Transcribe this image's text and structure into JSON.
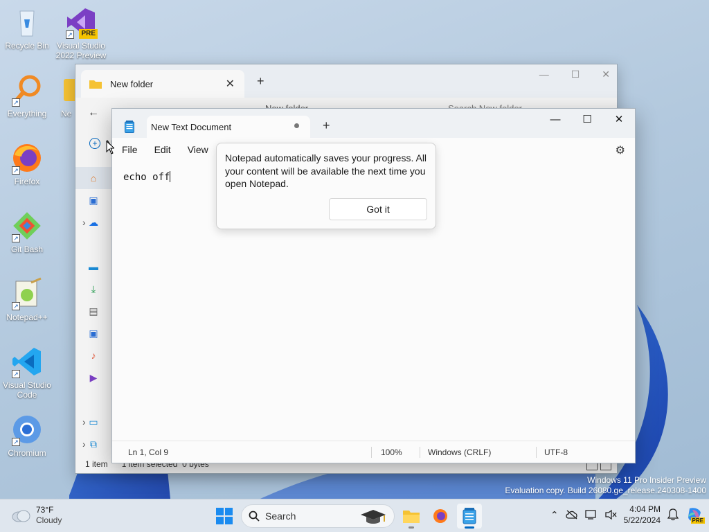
{
  "desktop": {
    "icons": [
      {
        "label": "Recycle Bin"
      },
      {
        "label": "Visual Studio 2022 Preview",
        "badge": "PRE"
      },
      {
        "label": "Everything"
      },
      {
        "label": "Firefox"
      },
      {
        "label": "Git Bash"
      },
      {
        "label": "Notepad++"
      },
      {
        "label": "Visual Studio Code"
      },
      {
        "label": "Chromium"
      }
    ],
    "partial_icon_label": "Ne"
  },
  "explorer": {
    "tab_title": "New folder",
    "address_partial": "New folder",
    "search_placeholder": "Search New folder",
    "new_button_partial": "N",
    "status_items": "1 item",
    "status_selected": "1 item selected  0 bytes"
  },
  "notepad": {
    "tab_title": "New Text Document",
    "menu": {
      "file": "File",
      "edit": "Edit",
      "view": "View"
    },
    "content": "echo off",
    "status": {
      "position": "Ln 1, Col 9",
      "zoom": "100%",
      "line_ending": "Windows (CRLF)",
      "encoding": "UTF-8"
    }
  },
  "teaching_tip": {
    "message": "Notepad automatically saves your progress. All your content will be available the next time you open Notepad.",
    "button": "Got it"
  },
  "watermark": {
    "line1": "Windows 11 Pro Insider Preview",
    "line2": "Evaluation copy. Build 26080.ge_release.240308-1400"
  },
  "taskbar": {
    "weather_temp": "73°F",
    "weather_cond": "Cloudy",
    "search_label": "Search",
    "time": "4:04 PM",
    "date": "5/22/2024",
    "copilot_badge": "PRE"
  },
  "colors": {
    "accent": "#0067c0",
    "folder": "#f5c233",
    "vs_purple": "#7b3fc4",
    "vscode_blue": "#23a6f0"
  }
}
